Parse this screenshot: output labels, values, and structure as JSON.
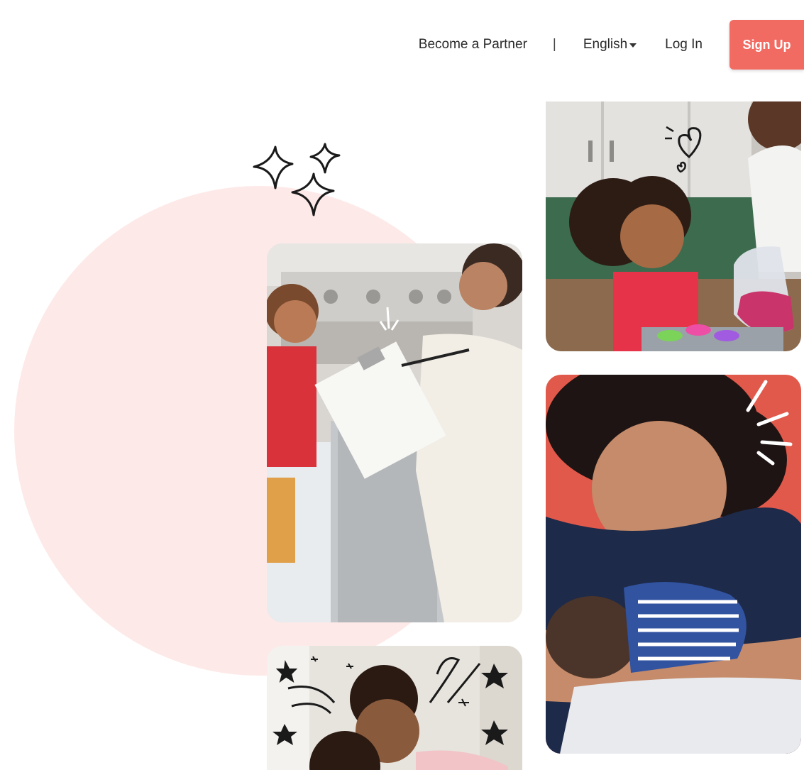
{
  "nav": {
    "become_partner": "Become a Partner",
    "separator": "|",
    "language": "English",
    "login": "Log In",
    "signup": "Sign Up"
  },
  "colors": {
    "accent": "#f26b63",
    "blob": "#fdeae8",
    "text": "#2a2a2a"
  },
  "icons": {
    "language_caret": "chevron-down-icon",
    "sparkles": "sparkles-icon"
  }
}
